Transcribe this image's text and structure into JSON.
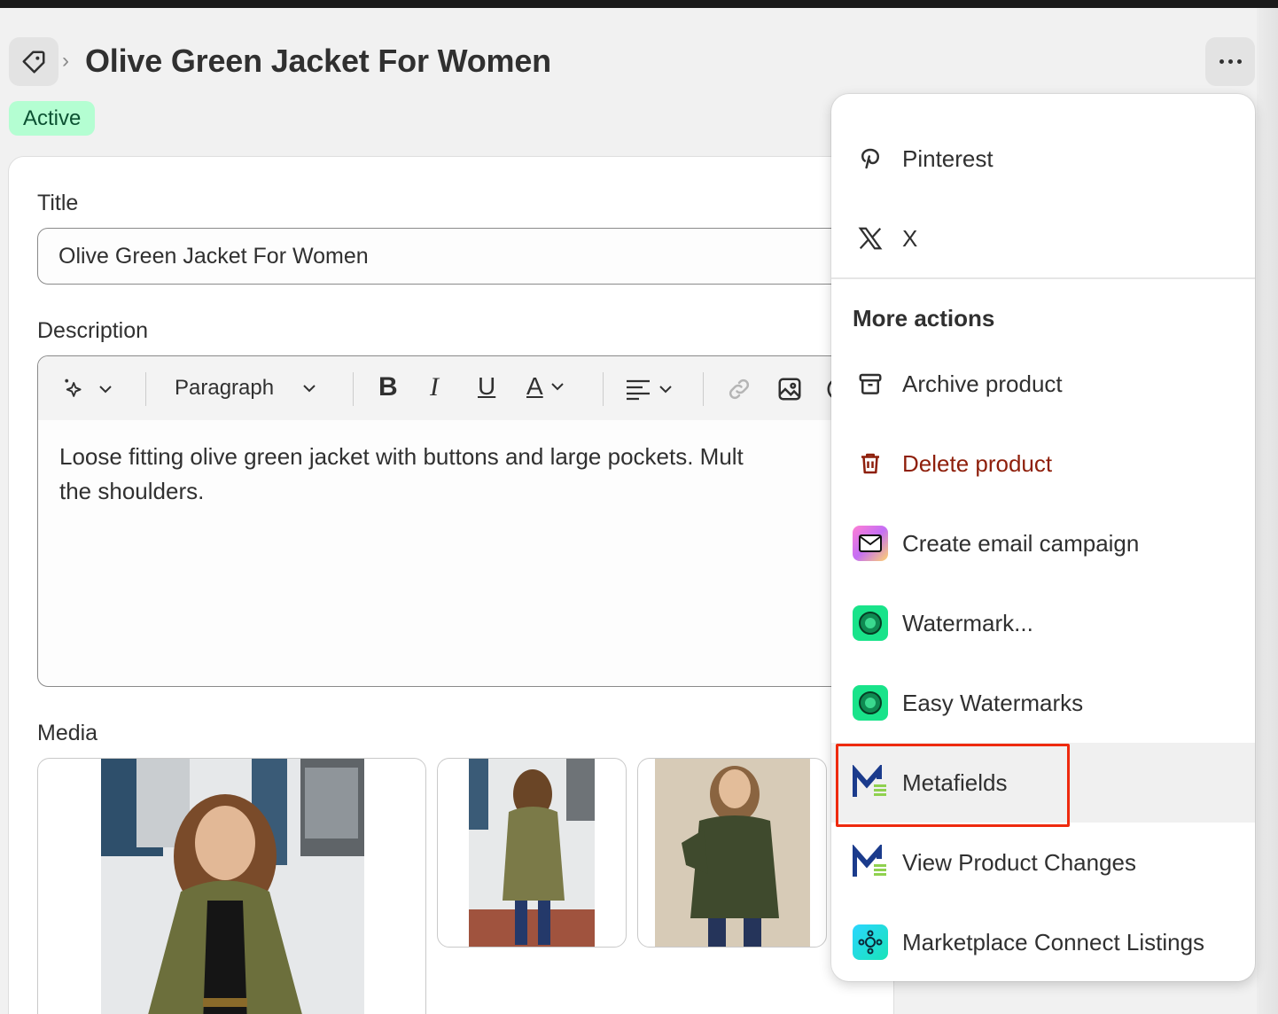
{
  "header": {
    "title": "Olive Green Jacket For Women",
    "breadcrumb_separator": "›",
    "status": "Active"
  },
  "form": {
    "title_label": "Title",
    "title_value": "Olive Green Jacket For Women",
    "description_label": "Description",
    "toolbar": {
      "paragraph_label": "Paragraph",
      "bold": "B",
      "italic": "I",
      "underline": "U",
      "text_color": "A"
    },
    "description_line1": "Loose fitting olive green jacket with buttons and large pockets. Mult",
    "description_line2": "the shoulders.",
    "media_label": "Media"
  },
  "menu": {
    "share_items": [
      {
        "label": "Pinterest",
        "icon": "pinterest-icon"
      },
      {
        "label": "X",
        "icon": "x-logo-icon"
      }
    ],
    "section_title": "More actions",
    "actions": [
      {
        "label": "Archive product",
        "icon": "archive-icon"
      },
      {
        "label": "Delete product",
        "icon": "trash-icon",
        "color": "#8e1f0b"
      },
      {
        "label": "Create email campaign",
        "icon": "email-app-icon"
      },
      {
        "label": "Watermark...",
        "icon": "watermark-app-icon"
      },
      {
        "label": "Easy Watermarks",
        "icon": "watermark-app-icon"
      },
      {
        "label": "Metafields",
        "icon": "metafields-app-icon",
        "highlighted": true
      },
      {
        "label": "View Product Changes",
        "icon": "metafields-app-icon"
      },
      {
        "label": "Marketplace Connect Listings",
        "icon": "marketplace-app-icon"
      }
    ]
  },
  "colors": {
    "status_bg": "#b4fed2",
    "status_text": "#0c5132",
    "danger": "#8e1f0b",
    "highlight_box": "#ee2a0e"
  }
}
